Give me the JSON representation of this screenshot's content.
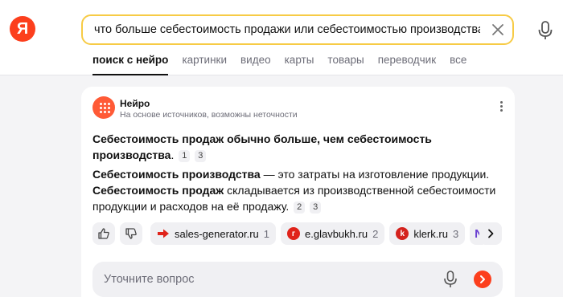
{
  "logo": {
    "letter": "Я"
  },
  "search": {
    "query": "что больше себестоимость продажи или себестоимостью производства"
  },
  "tabs": [
    {
      "label": "поиск с нейро",
      "active": true
    },
    {
      "label": "картинки"
    },
    {
      "label": "видео"
    },
    {
      "label": "карты"
    },
    {
      "label": "товары"
    },
    {
      "label": "переводчик"
    },
    {
      "label": "все"
    }
  ],
  "neuro": {
    "title": "Нейро",
    "subtitle": "На основе источников, возможны неточности",
    "answer1": {
      "bold": "Себестоимость продаж обычно больше, чем себестоимость производства",
      "rest": ".",
      "refs": [
        "1",
        "3"
      ]
    },
    "answer2": {
      "bold1": "Себестоимость производства",
      "text1": " — это затраты на изготовление продукции. ",
      "bold2": "Себестоимость продаж",
      "text2": " складывается из производственной себестоимости продукции и расходов на её продажу.",
      "refs": [
        "2",
        "3"
      ]
    },
    "sources": [
      {
        "name": "sales-generator.ru",
        "num": "1",
        "icon": "arrow-right-icon",
        "color": "#e0231a"
      },
      {
        "name": "e.glavbukh.ru",
        "num": "2",
        "icon": "glavbukh-icon",
        "color": "#e0231a"
      },
      {
        "name": "klerk.ru",
        "num": "3",
        "icon": "klerk-icon",
        "color": "#d4221d"
      },
      {
        "name": "",
        "num": "",
        "icon": "n-logo-icon",
        "color": "#6a3fd1"
      }
    ],
    "ask_placeholder": "Уточните вопрос"
  },
  "colors": {
    "brand": "#fc3f1d",
    "search_border": "#f7cb45"
  }
}
